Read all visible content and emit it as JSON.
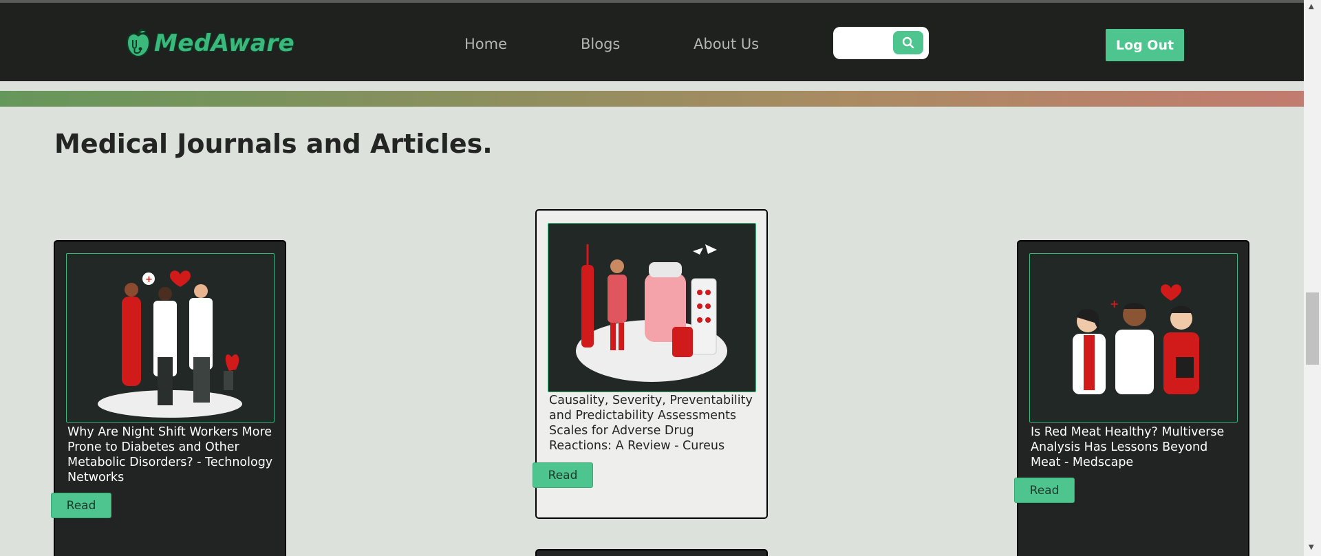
{
  "brand": {
    "name": "MedAware"
  },
  "nav": {
    "links": [
      "Home",
      "Blogs",
      "About Us"
    ],
    "search_placeholder": "",
    "logout_label": "Log Out"
  },
  "page": {
    "title": "Medical Journals and Articles."
  },
  "cards": [
    {
      "title": "Why Are Night Shift Workers More Prone to Diabetes and Other Metabolic Disorders? - Technology Networks",
      "button": "Read",
      "theme": "dark"
    },
    {
      "title": "Causality, Severity, Preventability and Predictability Assessments Scales for Adverse Drug Reactions: A Review - Cureus",
      "button": "Read",
      "theme": "light"
    },
    {
      "title": "Is Red Meat Healthy? Multiverse Analysis Has Lessons Beyond Meat - Medscape",
      "button": "Read",
      "theme": "dark"
    }
  ],
  "colors": {
    "accent": "#4ec48e",
    "navbar": "#1f211f",
    "background": "#dce1dc"
  }
}
